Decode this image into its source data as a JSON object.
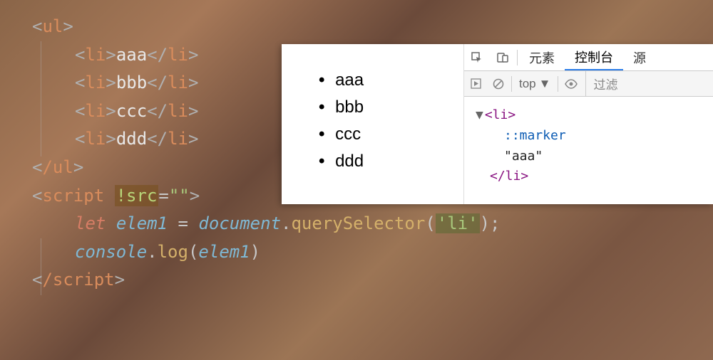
{
  "code": {
    "ul_open": "ul",
    "li": "li",
    "items": [
      "aaa",
      "bbb",
      "ccc",
      "ddd"
    ],
    "ul_close": "/ul",
    "script_open": "script",
    "src_attr": "!src",
    "src_val": "\"\"",
    "let": "let",
    "elem1": "elem1",
    "eq": " = ",
    "document": "document",
    "dot": ".",
    "querySelector": "querySelector",
    "paren_open": "(",
    "li_str": "'li'",
    "paren_close_semi": ");",
    "console": "console",
    "log": "log",
    "elem1_arg": "elem1",
    "paren_close": ")",
    "script_close": "/script"
  },
  "preview": {
    "items": [
      "aaa",
      "bbb",
      "ccc",
      "ddd"
    ]
  },
  "devtools": {
    "tabs": {
      "elements": "元素",
      "console": "控制台",
      "sources": "源"
    },
    "toolbar": {
      "top": "top",
      "filter": "过滤"
    },
    "elements": {
      "li_open": "<li>",
      "marker": "::marker",
      "text_content": "\"aaa\"",
      "li_close": "</li>"
    }
  }
}
